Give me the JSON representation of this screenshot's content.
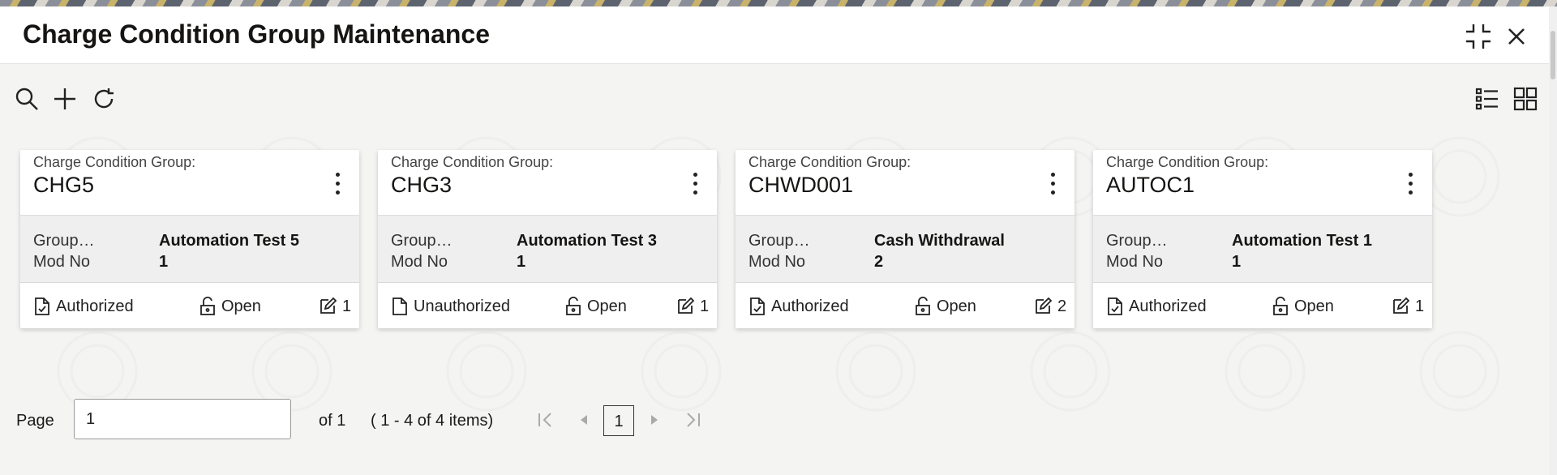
{
  "window": {
    "title": "Charge Condition Group Maintenance",
    "minimize_icon": "collapse-icon",
    "close_icon": "close-icon"
  },
  "toolbar": {
    "search_icon": "search-icon",
    "add_icon": "add-icon",
    "refresh_icon": "refresh-icon",
    "list_view_icon": "list-view-icon",
    "tile_view_icon": "tile-view-icon"
  },
  "cards": [
    {
      "label": "Charge Condition Group:",
      "code": "CHG5",
      "group_key": "Group…",
      "group_value": "Automation Test 5",
      "mod_key": "Mod No",
      "mod_value": "1",
      "auth_status": "Authorized",
      "record_status": "Open",
      "mod_count": "1"
    },
    {
      "label": "Charge Condition Group:",
      "code": "CHG3",
      "group_key": "Group…",
      "group_value": "Automation Test 3",
      "mod_key": "Mod No",
      "mod_value": "1",
      "auth_status": "Unauthorized",
      "record_status": "Open",
      "mod_count": "1"
    },
    {
      "label": "Charge Condition Group:",
      "code": "CHWD001",
      "group_key": "Group…",
      "group_value": "Cash Withdrawal",
      "mod_key": "Mod No",
      "mod_value": "2",
      "auth_status": "Authorized",
      "record_status": "Open",
      "mod_count": "2"
    },
    {
      "label": "Charge Condition Group:",
      "code": "AUTOC1",
      "group_key": "Group…",
      "group_value": "Automation Test 1",
      "mod_key": "Mod No",
      "mod_value": "1",
      "auth_status": "Authorized",
      "record_status": "Open",
      "mod_count": "1"
    }
  ],
  "pagination": {
    "page_label": "Page",
    "page_value": "1",
    "of_text": "of 1",
    "items_text": "( 1 - 4 of 4 items)",
    "current_page": "1"
  }
}
